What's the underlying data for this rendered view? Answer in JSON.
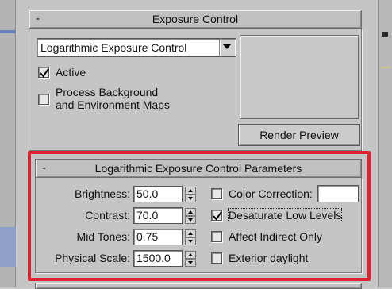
{
  "exposure_control": {
    "rollout_toggle": "-",
    "title": "Exposure Control",
    "type_select": {
      "value": "Logarithmic Exposure Control"
    },
    "active": {
      "label": "Active",
      "checked": true
    },
    "process_background": {
      "label_line1": "Process Background",
      "label_line2": "and Environment Maps",
      "checked": false
    },
    "render_preview_label": "Render Preview"
  },
  "log_params": {
    "rollout_toggle": "-",
    "title": "Logarithmic Exposure Control Parameters",
    "fields": [
      {
        "label": "Brightness:",
        "value": "50.0"
      },
      {
        "label": "Contrast:",
        "value": "70.0"
      },
      {
        "label": "Mid Tones:",
        "value": "0.75"
      },
      {
        "label": "Physical Scale:",
        "value": "1500.0"
      }
    ],
    "options": [
      {
        "label": "Color Correction:",
        "checked": false
      },
      {
        "label": "Desaturate Low Levels",
        "checked": true
      },
      {
        "label": "Affect Indirect Only",
        "checked": false
      },
      {
        "label": "Exterior daylight",
        "checked": false
      }
    ],
    "color_swatch": "#ffffff"
  },
  "colors": {
    "highlight": "#d8262e",
    "panel": "#c5c5c5"
  }
}
